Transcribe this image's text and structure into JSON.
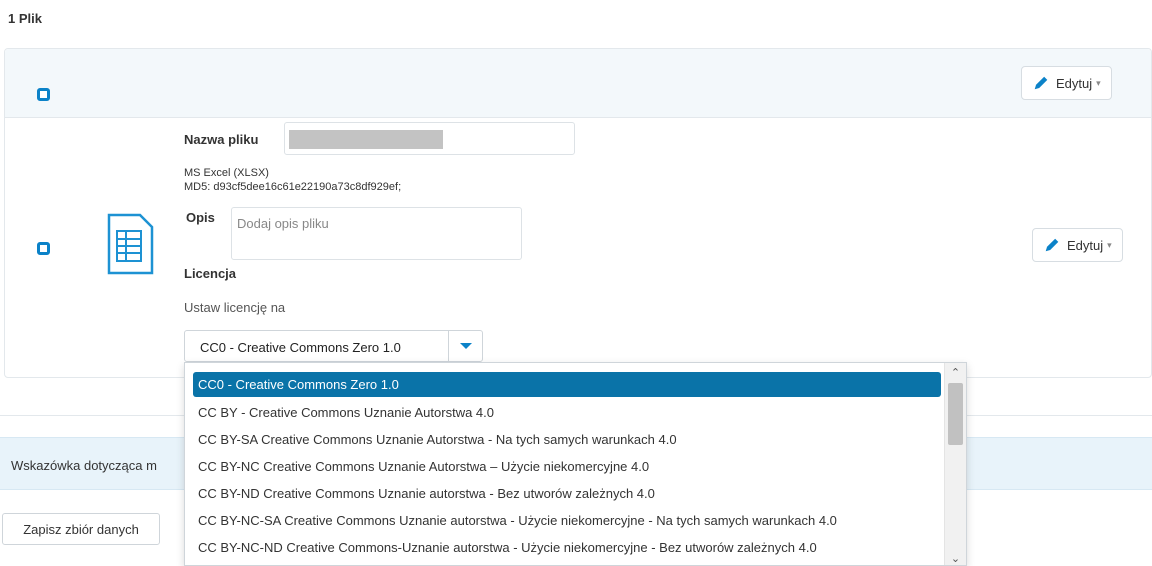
{
  "files_count": "1 Plik",
  "header_row": {
    "edit_label": "Edytuj"
  },
  "file": {
    "name_label": "Nazwa pliku",
    "format": "MS Excel (XLSX)",
    "md5": "MD5: d93cf5dee16c61e22190a73c8df929ef;",
    "description_label": "Opis",
    "description_placeholder": "Dodaj opis pliku",
    "license_label": "Licencja",
    "license_sublabel": "Ustaw licencję na",
    "license_selected": "CC0 - Creative Commons Zero 1.0",
    "edit_label": "Edytuj"
  },
  "license_options": [
    "CC0 - Creative Commons Zero 1.0",
    "CC BY - Creative Commons Uznanie Autorstwa 4.0",
    "CC BY-SA Creative Commons Uznanie Autorstwa - Na tych samych warunkach 4.0",
    "CC BY-NC Creative Commons Uznanie Autorstwa – Użycie niekomercyjne 4.0",
    "CC BY-ND Creative Commons Uznanie autorstwa - Bez utworów zależnych 4.0",
    "CC BY-NC-SA Creative Commons Uznanie autorstwa - Użycie niekomercyjne - Na tych samych warunkach 4.0",
    "CC BY-NC-ND Creative Commons-Uznanie autorstwa - Użycie niekomercyjne - Bez utworów zależnych 4.0"
  ],
  "hint_text": "Wskazówka dotycząca m",
  "save_label": "Zapisz zbiór danych",
  "colors": {
    "accent": "#0b82c8",
    "selected_option": "#0a73a8",
    "hint_bg": "#e8f3fa"
  },
  "icons": {
    "edit": "pencil-icon",
    "file": "spreadsheet-file-icon",
    "dropdown": "chevron-down-icon"
  }
}
